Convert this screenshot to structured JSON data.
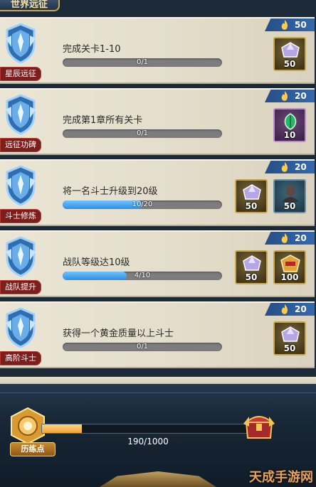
{
  "header": {
    "title": "世界远征"
  },
  "tasks": [
    {
      "category": "星辰远征",
      "description": "完成关卡1-10",
      "progress_text": "0/1",
      "progress": 0,
      "points": "50",
      "rewards": [
        {
          "type": "purple-gem",
          "qty": "50"
        }
      ]
    },
    {
      "category": "远征功碑",
      "description": "完成第1章所有关卡",
      "progress_text": "0/1",
      "progress": 0,
      "points": "20",
      "rewards": [
        {
          "type": "green-leaf",
          "qty": "10"
        }
      ]
    },
    {
      "category": "斗士修炼",
      "description": "将一名斗士升级到20级",
      "progress_text": "10/20",
      "progress": 0.5,
      "points": "20",
      "rewards": [
        {
          "type": "purple-gem",
          "qty": "50"
        },
        {
          "type": "hero-portrait",
          "qty": "50"
        }
      ]
    },
    {
      "category": "战队提升",
      "description": "战队等级达10级",
      "progress_text": "4/10",
      "progress": 0.4,
      "points": "20",
      "rewards": [
        {
          "type": "purple-gem",
          "qty": "50"
        },
        {
          "type": "gold-emblem",
          "qty": "100"
        }
      ]
    },
    {
      "category": "高阶斗士",
      "description": "获得一个黄金质量以上斗士",
      "progress_text": "0/1",
      "progress": 0,
      "points": "20",
      "rewards": [
        {
          "type": "purple-gem",
          "qty": "50"
        }
      ]
    }
  ],
  "summary": {
    "label": "历练点",
    "progress_text": "190/1000",
    "progress": 0.19
  },
  "watermark": "天成手游网",
  "colors": {
    "progress_blue": "#2f8fe0",
    "points_tab": "#3568ad",
    "category_red": "#7b1e1e",
    "total_fill": "#f0a43c"
  }
}
